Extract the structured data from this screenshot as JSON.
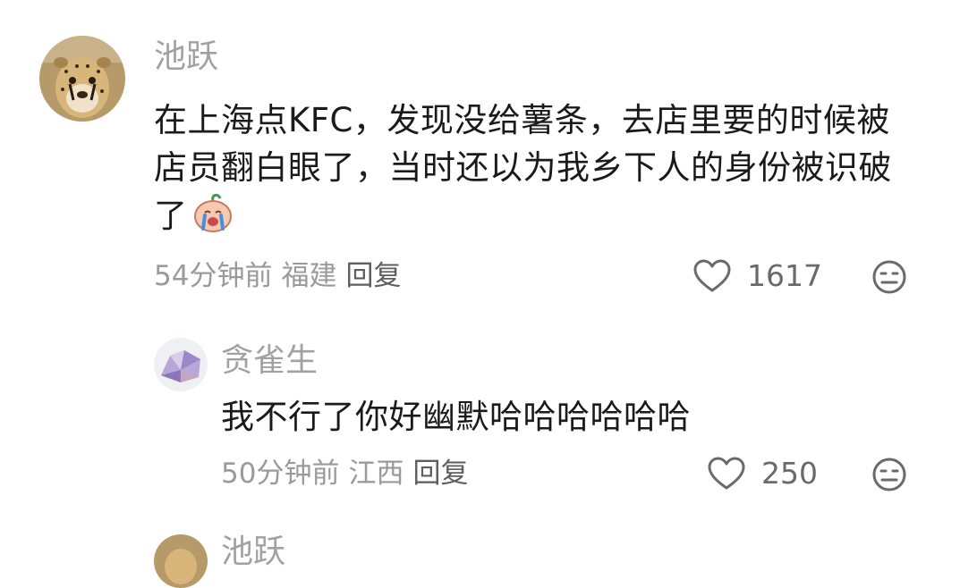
{
  "comments": [
    {
      "username": "池跃",
      "content": "在上海点KFC，发现没给薯条，去店里要的时候被店员翻白眼了，当时还以为我乡下人的身份被识破了",
      "time": "54分钟前",
      "location": "福建",
      "reply_label": "回复",
      "likes": "1617",
      "avatar_icon": "cheetah-avatar",
      "emoji_icon": "crying-face-emoji"
    },
    {
      "username": "贪雀生",
      "content": "我不行了你好幽默哈哈哈哈哈哈",
      "time": "50分钟前",
      "location": "江西",
      "reply_label": "回复",
      "likes": "250",
      "avatar_icon": "purple-crystal-avatar"
    },
    {
      "username": "池跃",
      "avatar_icon": "cheetah-avatar"
    }
  ],
  "colors": {
    "username": "#a1a1a1",
    "content": "#1a1a1a",
    "meta": "#9a9a9a",
    "reply": "#5e5e5e",
    "icon": "#6a6a6a"
  }
}
